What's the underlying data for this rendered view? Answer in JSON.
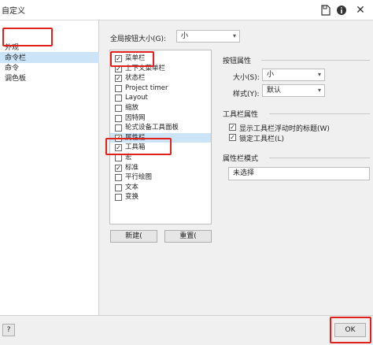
{
  "window": {
    "title": "自定义"
  },
  "titlebar_icons": [
    "save-page-icon",
    "info-icon",
    "close-icon"
  ],
  "tree": {
    "items": [
      {
        "label": "外观"
      },
      {
        "label": "命令栏",
        "selected": true
      },
      {
        "label": "命令"
      },
      {
        "label": "调色板"
      }
    ]
  },
  "global_button_size": {
    "label": "全局按钮大小(G):",
    "value": "小"
  },
  "command_bars": [
    {
      "label": "菜单栏",
      "checked": true
    },
    {
      "label": "上下文菜单栏",
      "checked": true
    },
    {
      "label": "状态栏",
      "checked": true
    },
    {
      "label": "Project timer",
      "checked": false
    },
    {
      "label": "Layout",
      "checked": false
    },
    {
      "label": "缩放",
      "checked": false
    },
    {
      "label": "因特网",
      "checked": false
    },
    {
      "label": "轮式设备工具面板",
      "checked": false
    },
    {
      "label": "属性栏",
      "checked": true,
      "highlighted": true
    },
    {
      "label": "工具箱",
      "checked": true
    },
    {
      "label": "宏",
      "checked": false
    },
    {
      "label": "标准",
      "checked": true
    },
    {
      "label": "平行绘图",
      "checked": false
    },
    {
      "label": "文本",
      "checked": false
    },
    {
      "label": "变换",
      "checked": false
    }
  ],
  "buttons": {
    "new": "新建(",
    "reset": "重置("
  },
  "button_props": {
    "heading": "按钮属性",
    "size_label": "大小(S):",
    "size_value": "小",
    "style_label": "样式(Y):",
    "style_value": "默认"
  },
  "toolbar_props": {
    "heading": "工具栏属性",
    "show_title": {
      "label": "显示工具栏浮动时的标题(W)",
      "checked": true
    },
    "lock": {
      "label": "锁定工具栏(L)",
      "checked": true
    }
  },
  "property_mode": {
    "heading": "属性栏模式",
    "value": "未选择"
  },
  "footer": {
    "help": "?",
    "ok": "OK"
  }
}
